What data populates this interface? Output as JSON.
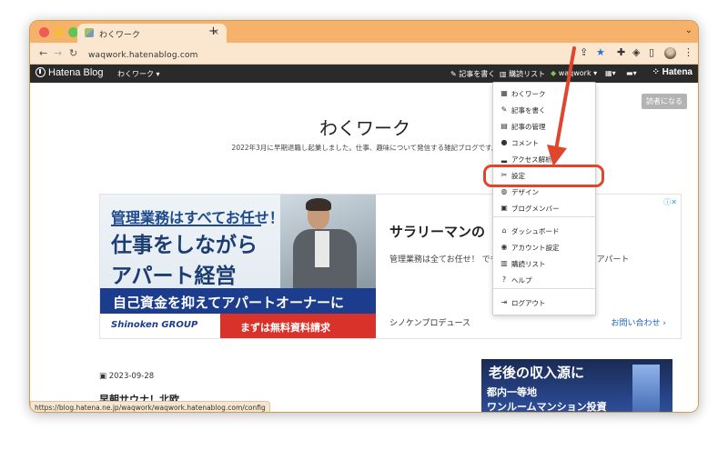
{
  "browser": {
    "tab_title": "わくワーク",
    "tab_close": "×",
    "new_tab": "+",
    "tab_menu": "⌄",
    "url": "waqwork.hatenablog.com",
    "colors": {
      "titlebar": "#f6b26b",
      "toolbar": "#fbe7d0"
    }
  },
  "hatena_bar": {
    "logo": "Hatena Blog",
    "blog_select": "わくワーク ▾",
    "write": "記事を書く",
    "reading_list": "購読リスト",
    "user": "waqwork ▾",
    "apps": "▾",
    "notify": "▾",
    "brand": "Hatena"
  },
  "blog": {
    "reader_button": "読者になる",
    "title": "わくワーク",
    "description": "2022年3月に早期退職し起業しました。仕事、趣味について発信する雑記ブログです。"
  },
  "ad": {
    "headline1": "管理業務はすべてお任せ！",
    "headline2": "仕事をしながら",
    "headline3": "アパート経営",
    "band": "自己資金を抑えてアパートオーナーに",
    "logo": "Shinoken GROUP",
    "cta": "まずは無料資料請求",
    "title": "サラリーマンの",
    "body": "管理業務は全てお任せ！ でも家賃収入を受け取るだけでアパート",
    "sponsor": "シノケンプロデュース",
    "contact": "お問い合わせ ›",
    "adchoices": "ⓘ✕"
  },
  "post": {
    "date": "2023-09-28",
    "title": "早朝サウナ！北欧"
  },
  "side_ad": {
    "line1": "老後の収入源に",
    "line2": "都内一等地",
    "line3": "ワンルームマンション投資"
  },
  "status_url": "https://blog.hatena.ne.jp/waqwork/waqwork.hatenablog.com/config",
  "menu": {
    "items": [
      {
        "label": "わくワーク",
        "icon": "blog-icon",
        "glyph": "▦"
      },
      {
        "label": "記事を書く",
        "icon": "edit-icon",
        "glyph": "✎"
      },
      {
        "label": "記事の管理",
        "icon": "document-icon",
        "glyph": "▤"
      },
      {
        "label": "コメント",
        "icon": "comment-icon",
        "glyph": "●"
      },
      {
        "label": "アクセス解析",
        "icon": "chart-icon",
        "glyph": "▂"
      },
      {
        "label": "設定",
        "icon": "wrench-icon",
        "glyph": "✂"
      },
      {
        "label": "デザイン",
        "icon": "palette-icon",
        "glyph": "◍"
      },
      {
        "label": "ブログメンバー",
        "icon": "members-icon",
        "glyph": "▣"
      },
      {
        "label": "ダッシュボード",
        "icon": "home-icon",
        "glyph": "⌂"
      },
      {
        "label": "アカウント設定",
        "icon": "user-icon",
        "glyph": "◉"
      },
      {
        "label": "購読リスト",
        "icon": "reading-list-icon",
        "glyph": "▥"
      },
      {
        "label": "ヘルプ",
        "icon": "help-icon",
        "glyph": "?"
      },
      {
        "label": "ログアウト",
        "icon": "logout-icon",
        "glyph": "⇥"
      }
    ]
  },
  "annotation_color": "#e0462e"
}
